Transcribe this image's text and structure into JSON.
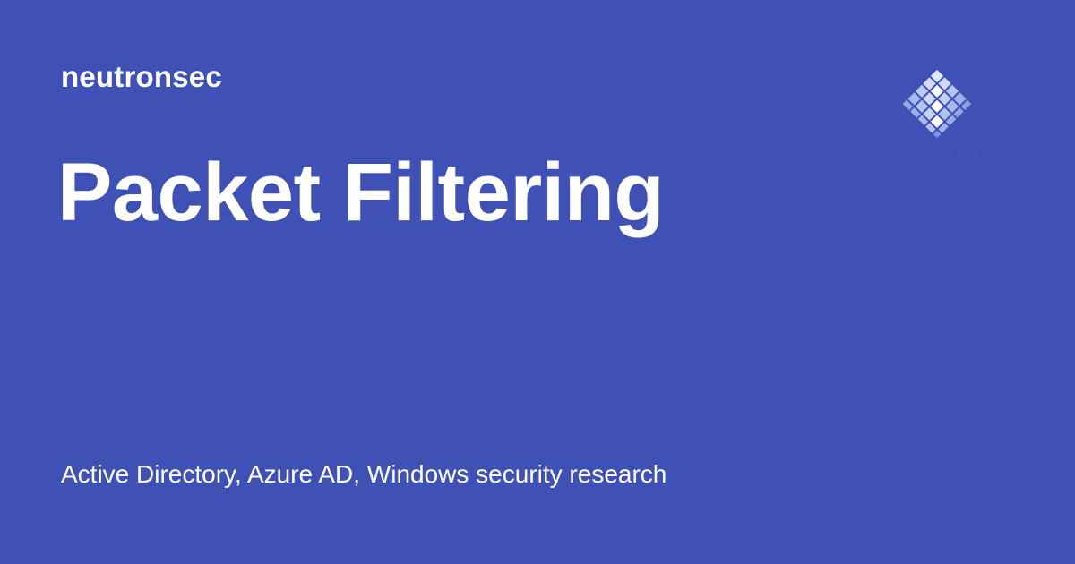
{
  "site": {
    "name": "neutronsec"
  },
  "page": {
    "title": "Packet Filtering",
    "description": "Active Directory, Azure AD, Windows security research"
  },
  "logo": {
    "icon": "diamond-grid-logo-icon",
    "text": "neutronsec"
  },
  "colors": {
    "background": "#3f51b5",
    "text": "#ffffff",
    "logo_light": "#dfe7fb",
    "logo_mid": "#a8b9ee",
    "logo_dark": "#7f93de"
  }
}
